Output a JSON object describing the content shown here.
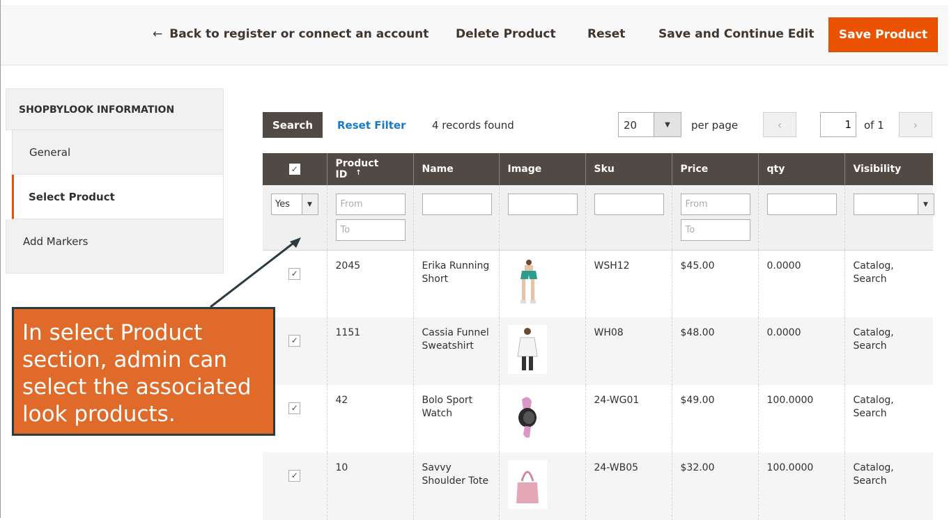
{
  "topbar": {
    "back_label": "Back to register or connect an account",
    "delete_label": "Delete Product",
    "reset_label": "Reset",
    "save_continue_label": "Save and Continue Edit",
    "save_label": "Save Product"
  },
  "sidebar": {
    "title": "SHOPBYLOOK INFORMATION",
    "items": [
      {
        "label": "General"
      },
      {
        "label": "Select Product"
      },
      {
        "label": "Add Markers"
      }
    ]
  },
  "toolbar": {
    "search_label": "Search",
    "reset_filter_label": "Reset Filter",
    "records_found": "4 records found",
    "per_page_value": "20",
    "per_page_label": "per page",
    "current_page": "1",
    "of_pages": "of 1"
  },
  "grid": {
    "columns": [
      "Product ID",
      "Name",
      "Image",
      "Sku",
      "Price",
      "qty",
      "Visibility"
    ],
    "filters": {
      "selected": "Yes",
      "id_from": "From",
      "id_to": "To",
      "price_from": "From",
      "price_to": "To"
    },
    "rows": [
      {
        "id": "2045",
        "name": "Erika Running Short",
        "sku": "WSH12",
        "price": "$45.00",
        "qty": "0.0000",
        "visibility": "Catalog, Search",
        "image": "shorts-image"
      },
      {
        "id": "1151",
        "name": "Cassia Funnel Sweatshirt",
        "sku": "WH08",
        "price": "$48.00",
        "qty": "0.0000",
        "visibility": "Catalog, Search",
        "image": "sweatshirt-image"
      },
      {
        "id": "42",
        "name": "Bolo Sport Watch",
        "sku": "24-WG01",
        "price": "$49.00",
        "qty": "100.0000",
        "visibility": "Catalog, Search",
        "image": "watch-image"
      },
      {
        "id": "10",
        "name": "Savvy Shoulder Tote",
        "sku": "24-WB05",
        "price": "$32.00",
        "qty": "100.0000",
        "visibility": "Catalog, Search",
        "image": "tote-image"
      }
    ]
  },
  "callout": {
    "text": "In select Product section, admin can select the associated look products."
  },
  "colors": {
    "accent": "#eb5202",
    "header_dark": "#514943",
    "link": "#1979c3",
    "callout_bg": "#e06a2a",
    "callout_border": "#2c3b40"
  }
}
